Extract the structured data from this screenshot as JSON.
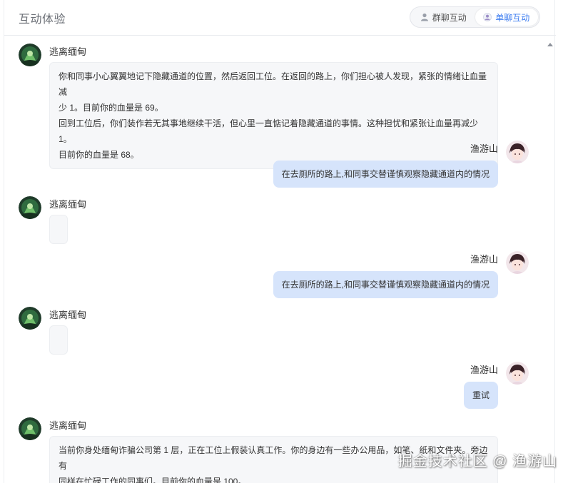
{
  "header": {
    "title": "互动体验",
    "tabs": [
      {
        "label": "群聊互动",
        "icon": "user-icon",
        "active": false
      },
      {
        "label": "单聊互动",
        "icon": "user-avatar-icon",
        "active": true
      }
    ]
  },
  "messages": [
    {
      "role": "bot",
      "name": "逃离缅甸",
      "lines": [
        "你和同事小心翼翼地记下隐藏通道的位置，然后返回工位。在返回的路上，你们担心被人发现，紧张的情绪让血量减",
        "少 1。目前你的血量是 69。",
        "回到工位后，你们装作若无其事地继续干活，但心里一直惦记着隐藏通道的事情。这种担忧和紧张让血量再减少 1。",
        "目前你的血量是 68。"
      ]
    },
    {
      "role": "user",
      "name": "渔游山",
      "text": "在去厕所的路上,和同事交替谨慎观察隐藏通道内的情况"
    },
    {
      "role": "bot",
      "name": "逃离缅甸",
      "lines": []
    },
    {
      "role": "user",
      "name": "渔游山",
      "text": "在去厕所的路上,和同事交替谨慎观察隐藏通道内的情况"
    },
    {
      "role": "bot",
      "name": "逃离缅甸",
      "lines": []
    },
    {
      "role": "user",
      "name": "渔游山",
      "text": "重试"
    },
    {
      "role": "bot",
      "name": "逃离缅甸",
      "lines": [
        "当前你身处缅甸诈骗公司第 1 层，正在工位上假装认真工作。你的身边有一些办公用品，如笔、纸和文件夹。旁边有",
        "同样在忙碌工作的同事们。目前你的血量是 100。"
      ]
    }
  ],
  "watermark": "掘金技术社区 @ 渔游山",
  "colors": {
    "accent": "#3a7bf0",
    "user_bubble": "#d6e4fb",
    "bot_bubble": "#f6f7f9"
  }
}
